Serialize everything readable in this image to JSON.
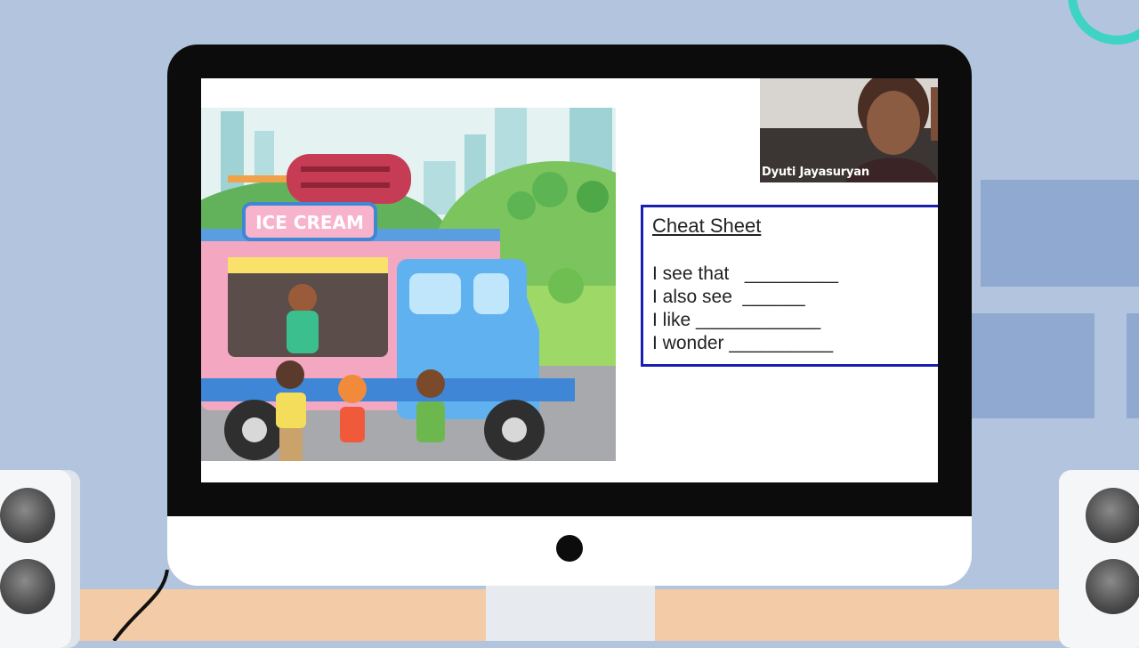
{
  "webcam": {
    "participant_name": "Dyuti Jayasuryan"
  },
  "slide": {
    "truck_sign": "ICE CREAM",
    "cheat_sheet": {
      "title": "Cheat Sheet",
      "lines": [
        "I see that   _________",
        "I also see  ______",
        "I like ____________",
        "I wonder __________"
      ]
    }
  }
}
